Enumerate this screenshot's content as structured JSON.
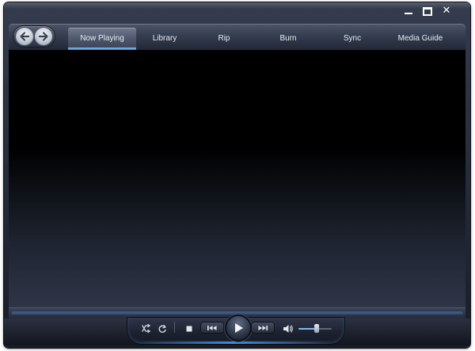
{
  "window": {
    "caption_buttons": [
      "minimize-icon",
      "maximize-icon",
      "close-icon"
    ]
  },
  "nav": {
    "back_icon": "arrow-left-icon",
    "forward_icon": "arrow-right-icon",
    "tabs": [
      {
        "label": "Now Playing",
        "active": true
      },
      {
        "label": "Library",
        "active": false
      },
      {
        "label": "Rip",
        "active": false
      },
      {
        "label": "Burn",
        "active": false
      },
      {
        "label": "Sync",
        "active": false
      },
      {
        "label": "Media Guide",
        "active": false
      }
    ]
  },
  "controls": {
    "icons": [
      "shuffle-icon",
      "repeat-icon",
      "stop-icon",
      "previous-icon",
      "play-icon",
      "next-icon",
      "volume-icon"
    ],
    "volume_level": 0.55
  },
  "colors": {
    "accent_blue": "#3c8fd8",
    "chrome_dark": "#232a38",
    "tab_text": "#e8ecf3"
  }
}
